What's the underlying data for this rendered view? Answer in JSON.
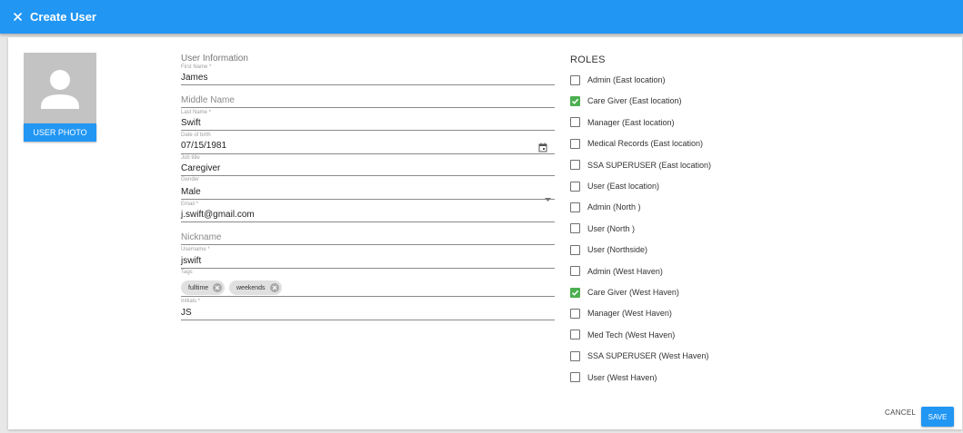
{
  "header": {
    "title": "Create User",
    "bg_color": "#2196f3",
    "close_icon": "close-icon"
  },
  "photo": {
    "avatar_icon": "person-icon",
    "button_label": "USER PHOTO"
  },
  "user_info": {
    "section_title": "User Information",
    "first_name": {
      "label": "First Name *",
      "value": "James"
    },
    "middle_name": {
      "placeholder": "Middle Name"
    },
    "last_name": {
      "label": "Last Name *",
      "value": "Swift"
    },
    "dob": {
      "label": "Date of birth",
      "value": "07/15/1981",
      "icon": "calendar-icon"
    },
    "job_title": {
      "label": "Job title",
      "value": "Caregiver"
    },
    "gender": {
      "label": "Gender",
      "value": "Male",
      "icon": "dropdown-arrow-icon"
    },
    "email": {
      "label": "Email *",
      "value": "j.swift@gmail.com"
    },
    "nickname": {
      "placeholder": "Nickname"
    },
    "username": {
      "label": "Username *",
      "value": "jswift"
    },
    "tags": {
      "label": "Tags",
      "items": [
        "fulltime",
        "weekends"
      ]
    },
    "initials": {
      "label": "Initials *",
      "value": "JS"
    }
  },
  "roles": {
    "title": "ROLES",
    "check_color": "#4caf50",
    "items": [
      {
        "label": "Admin (East location)",
        "checked": false
      },
      {
        "label": "Care Giver (East location)",
        "checked": true
      },
      {
        "label": "Manager (East location)",
        "checked": false
      },
      {
        "label": "Medical Records (East location)",
        "checked": false
      },
      {
        "label": "SSA SUPERUSER (East location)",
        "checked": false
      },
      {
        "label": "User (East location)",
        "checked": false
      },
      {
        "label": "Admin (North )",
        "checked": false
      },
      {
        "label": "User (North )",
        "checked": false
      },
      {
        "label": "User (Northside)",
        "checked": false
      },
      {
        "label": "Admin (West Haven)",
        "checked": false
      },
      {
        "label": "Care Giver (West Haven)",
        "checked": true
      },
      {
        "label": "Manager (West Haven)",
        "checked": false
      },
      {
        "label": "Med Tech (West Haven)",
        "checked": false
      },
      {
        "label": "SSA SUPERUSER (West Haven)",
        "checked": false
      },
      {
        "label": "User (West Haven)",
        "checked": false
      }
    ]
  },
  "actions": {
    "cancel_label": "CANCEL",
    "save_label": "SAVE"
  }
}
